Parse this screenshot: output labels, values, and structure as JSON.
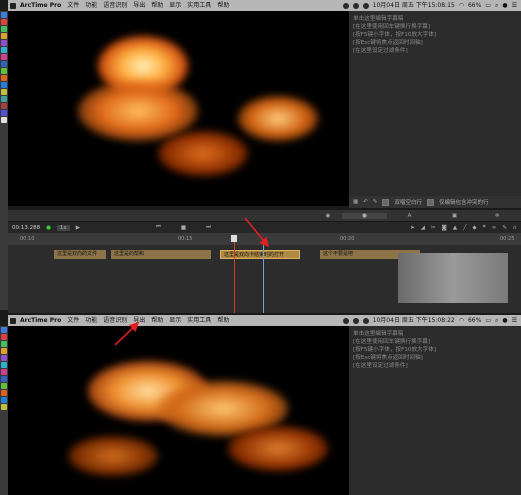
{
  "top_menubar": {
    "app_name": "ArcTime Pro",
    "items": [
      "文件",
      "功能",
      "语音识别",
      "导出",
      "帮助",
      "显示",
      "实用工具",
      "帮助"
    ],
    "battery": "66%",
    "clock": "10月04日 周五 下午15:08:15"
  },
  "bottom_menubar": {
    "app_name": "ArcTime Pro",
    "items": [
      "文件",
      "功能",
      "语音识别",
      "导出",
      "帮助",
      "显示",
      "实用工具",
      "帮助"
    ],
    "battery": "66%",
    "clock": "10月04日 周五 下午15:08:22"
  },
  "notes_top": {
    "lines": [
      "单击这里编辑字幕稿",
      "[在这里使用回车键换行换字幕]",
      "[按F5键小字体，按F10放大字体]",
      "[按Esc键将焦点返回时间轴]",
      "[在这里设定过滤条件]"
    ]
  },
  "notes_bottom": {
    "lines": [
      "单击这里编辑字幕稿",
      "[在这里使用回车键换行换字幕]",
      "[按F5键小字体，按F10放大字体]",
      "[按Esc键将焦点返回时间轴]",
      "[在这里设定过滤条件]"
    ]
  },
  "panel_toolbar": {
    "option1": "双唱空白行",
    "option2": "仅编辑包含冲突的行",
    "tab_icons": [
      "speech-bubble-icon",
      "text-icon",
      "grid-icon",
      "settings-icon"
    ]
  },
  "transport": {
    "timecode": "00:13.288",
    "zoom": "1x"
  },
  "ruler": {
    "ticks": [
      "00:10",
      "00:15",
      "00:20",
      "00:25"
    ]
  },
  "clips": [
    {
      "label": "这里是双向的文件"
    },
    {
      "label": "这里是的帮和"
    },
    {
      "label": "这里是双向卡结束时的打开"
    },
    {
      "label": "这个不要是吧"
    }
  ],
  "colors": {
    "menubar": "#b6b6b6",
    "panel": "#2b2b2b",
    "clip": "#8d7448",
    "arrow": "#e02020",
    "playhead": "#d04020"
  }
}
